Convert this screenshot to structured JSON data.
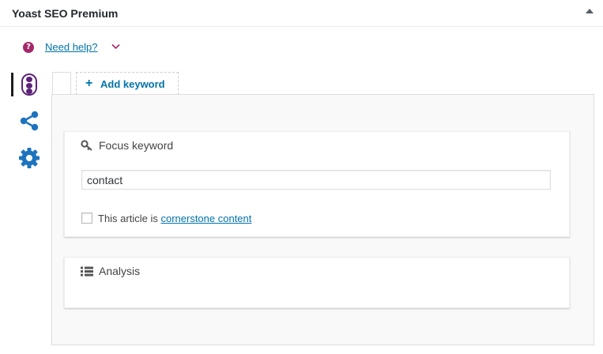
{
  "header": {
    "title": "Yoast SEO Premium"
  },
  "help": {
    "label": "Need help?",
    "icon": "question-circle-icon"
  },
  "side_tabs": [
    {
      "name": "readability",
      "icon": "traffic-light-icon",
      "active": true
    },
    {
      "name": "social",
      "icon": "share-icon"
    },
    {
      "name": "advanced",
      "icon": "gear-icon"
    }
  ],
  "keyword_tabs": {
    "add_label": "Add keyword"
  },
  "focus": {
    "title": "Focus keyword",
    "input_value": "contact",
    "cornerstone_prefix": "This article is ",
    "cornerstone_link": "cornerstone content",
    "cornerstone_checked": false
  },
  "analysis": {
    "title": "Analysis"
  },
  "colors": {
    "accent": "#a4286a",
    "link": "#0073aa",
    "traffic": "#5d237a"
  }
}
